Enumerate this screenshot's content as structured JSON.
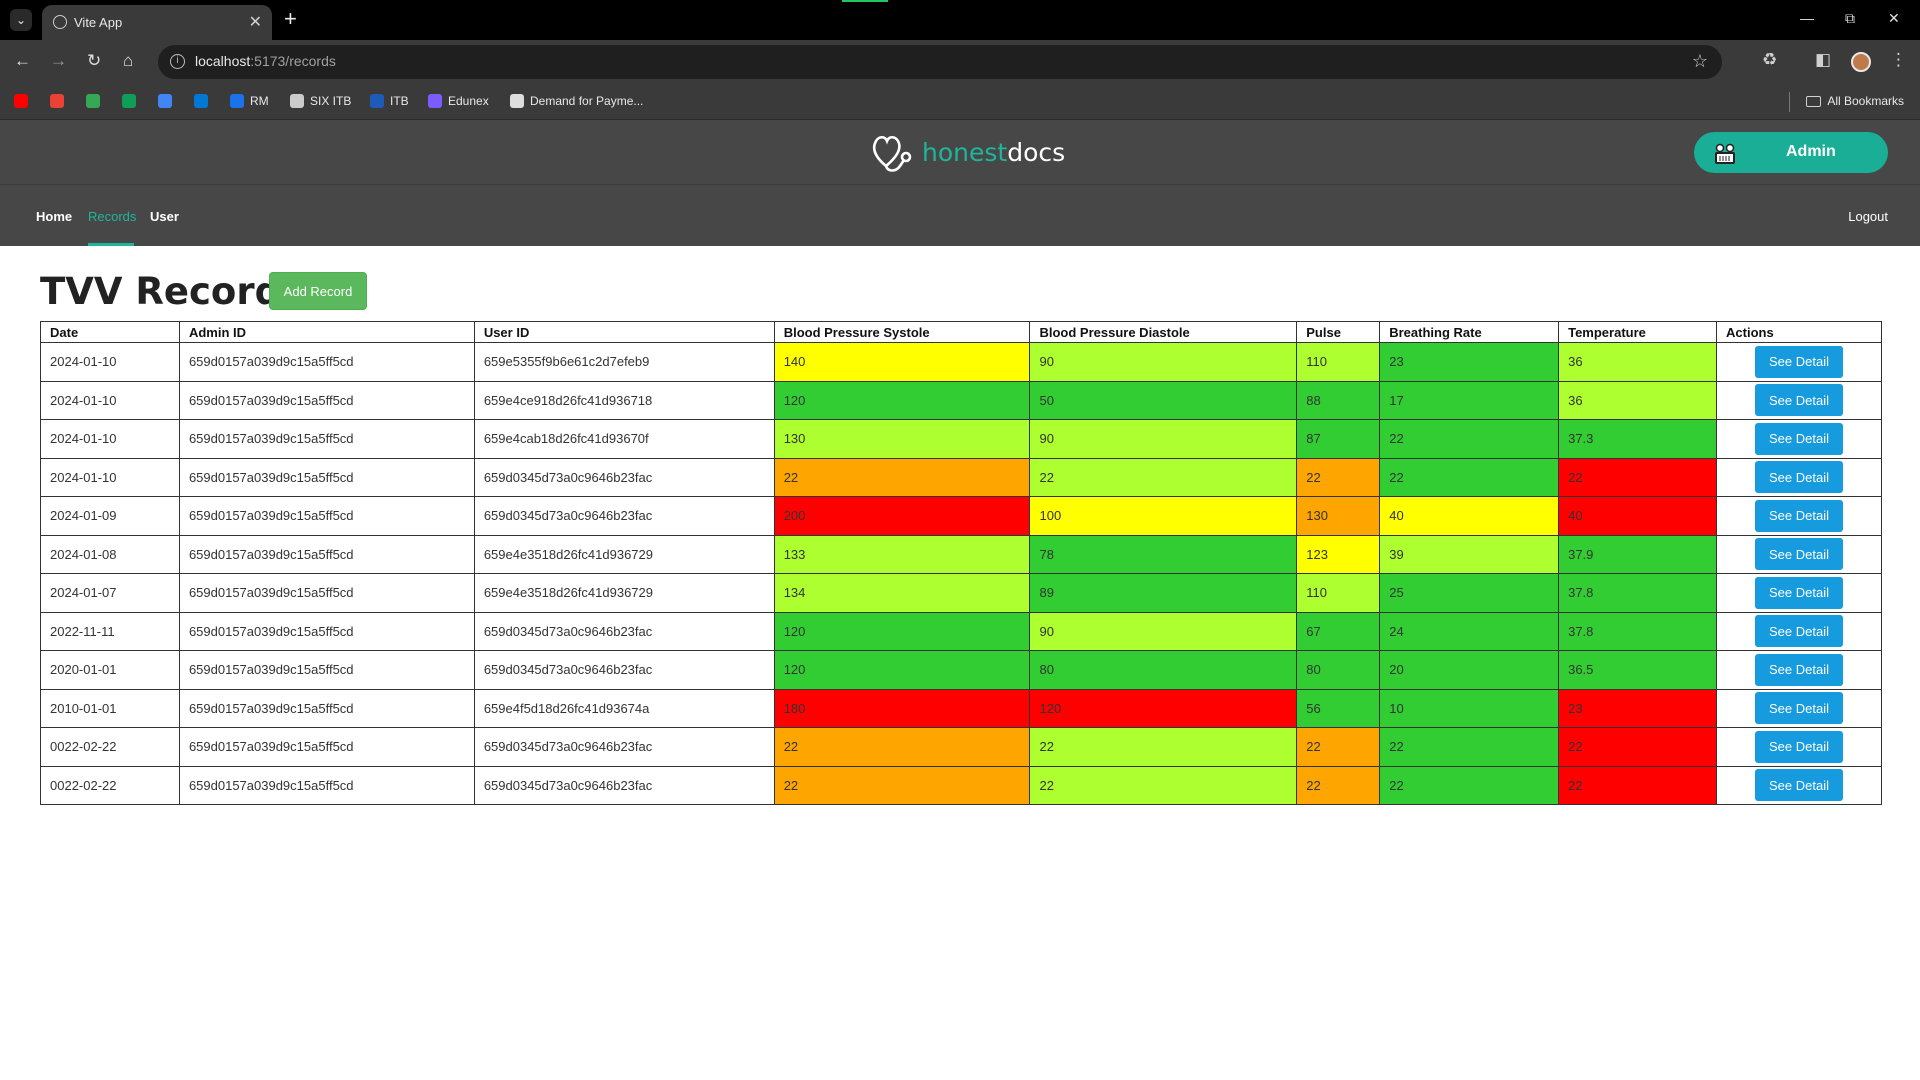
{
  "browser": {
    "tab_title": "Vite App",
    "url_host": "localhost",
    "url_path": ":5173/records",
    "bookmarks": [
      {
        "label": "",
        "icon": "youtube-icon",
        "color": "#ff0000"
      },
      {
        "label": "",
        "icon": "gmail-icon",
        "color": "#ea4335"
      },
      {
        "label": "",
        "icon": "drive-icon",
        "color": "#34a853"
      },
      {
        "label": "",
        "icon": "classroom-icon",
        "color": "#0f9d58"
      },
      {
        "label": "",
        "icon": "calendar-icon",
        "color": "#4285f4"
      },
      {
        "label": "",
        "icon": "outlook-icon",
        "color": "#0078d4"
      },
      {
        "label": "RM",
        "icon": "rm-icon",
        "color": "#1a73e8"
      },
      {
        "label": "SIX ITB",
        "icon": "six-itb-icon",
        "color": "#cccccc"
      },
      {
        "label": "ITB",
        "icon": "itb-icon",
        "color": "#1e5bb8"
      },
      {
        "label": "Edunex",
        "icon": "edunex-icon",
        "color": "#7c5cff"
      },
      {
        "label": "Demand for Payme...",
        "icon": "document-icon",
        "color": "#dddddd"
      }
    ],
    "all_bookmarks": "All Bookmarks"
  },
  "app": {
    "brand_honest": "honest",
    "brand_docs": "docs",
    "user_button": "Admin",
    "nav": {
      "home": "Home",
      "records": "Records",
      "user": "User",
      "logout": "Logout"
    },
    "accent": "#1fb59a"
  },
  "page": {
    "title": "TVV Records",
    "add_button": "Add Record",
    "columns": [
      "Date",
      "Admin ID",
      "User ID",
      "Blood Pressure Systole",
      "Blood Pressure Diastole",
      "Pulse",
      "Breathing Rate",
      "Temperature",
      "Actions"
    ],
    "detail_label": "See Detail",
    "status_colors": {
      "green": "#32cd32",
      "lime": "#adff2f",
      "yellow": "#ffff00",
      "orange": "#ffa500",
      "red": "#ff0000"
    },
    "rows": [
      {
        "date": "2024-01-10",
        "admin_id": "659d0157a039d9c15a5ff5cd",
        "user_id": "659e5355f9b6e61c2d7efeb9",
        "systole": {
          "v": "140",
          "s": "yellow"
        },
        "diastole": {
          "v": "90",
          "s": "lime"
        },
        "pulse": {
          "v": "110",
          "s": "lime"
        },
        "breathing": {
          "v": "23",
          "s": "green"
        },
        "temperature": {
          "v": "36",
          "s": "lime"
        }
      },
      {
        "date": "2024-01-10",
        "admin_id": "659d0157a039d9c15a5ff5cd",
        "user_id": "659e4ce918d26fc41d936718",
        "systole": {
          "v": "120",
          "s": "green"
        },
        "diastole": {
          "v": "50",
          "s": "green"
        },
        "pulse": {
          "v": "88",
          "s": "green"
        },
        "breathing": {
          "v": "17",
          "s": "green"
        },
        "temperature": {
          "v": "36",
          "s": "lime"
        }
      },
      {
        "date": "2024-01-10",
        "admin_id": "659d0157a039d9c15a5ff5cd",
        "user_id": "659e4cab18d26fc41d93670f",
        "systole": {
          "v": "130",
          "s": "lime"
        },
        "diastole": {
          "v": "90",
          "s": "lime"
        },
        "pulse": {
          "v": "87",
          "s": "green"
        },
        "breathing": {
          "v": "22",
          "s": "green"
        },
        "temperature": {
          "v": "37.3",
          "s": "green"
        }
      },
      {
        "date": "2024-01-10",
        "admin_id": "659d0157a039d9c15a5ff5cd",
        "user_id": "659d0345d73a0c9646b23fac",
        "systole": {
          "v": "22",
          "s": "orange"
        },
        "diastole": {
          "v": "22",
          "s": "lime"
        },
        "pulse": {
          "v": "22",
          "s": "orange"
        },
        "breathing": {
          "v": "22",
          "s": "green"
        },
        "temperature": {
          "v": "22",
          "s": "red"
        }
      },
      {
        "date": "2024-01-09",
        "admin_id": "659d0157a039d9c15a5ff5cd",
        "user_id": "659d0345d73a0c9646b23fac",
        "systole": {
          "v": "200",
          "s": "red"
        },
        "diastole": {
          "v": "100",
          "s": "yellow"
        },
        "pulse": {
          "v": "130",
          "s": "orange"
        },
        "breathing": {
          "v": "40",
          "s": "yellow"
        },
        "temperature": {
          "v": "40",
          "s": "red"
        }
      },
      {
        "date": "2024-01-08",
        "admin_id": "659d0157a039d9c15a5ff5cd",
        "user_id": "659e4e3518d26fc41d936729",
        "systole": {
          "v": "133",
          "s": "lime"
        },
        "diastole": {
          "v": "78",
          "s": "green"
        },
        "pulse": {
          "v": "123",
          "s": "yellow"
        },
        "breathing": {
          "v": "39",
          "s": "lime"
        },
        "temperature": {
          "v": "37.9",
          "s": "green"
        }
      },
      {
        "date": "2024-01-07",
        "admin_id": "659d0157a039d9c15a5ff5cd",
        "user_id": "659e4e3518d26fc41d936729",
        "systole": {
          "v": "134",
          "s": "lime"
        },
        "diastole": {
          "v": "89",
          "s": "green"
        },
        "pulse": {
          "v": "110",
          "s": "lime"
        },
        "breathing": {
          "v": "25",
          "s": "green"
        },
        "temperature": {
          "v": "37.8",
          "s": "green"
        }
      },
      {
        "date": "2022-11-11",
        "admin_id": "659d0157a039d9c15a5ff5cd",
        "user_id": "659d0345d73a0c9646b23fac",
        "systole": {
          "v": "120",
          "s": "green"
        },
        "diastole": {
          "v": "90",
          "s": "lime"
        },
        "pulse": {
          "v": "67",
          "s": "green"
        },
        "breathing": {
          "v": "24",
          "s": "green"
        },
        "temperature": {
          "v": "37.8",
          "s": "green"
        }
      },
      {
        "date": "2020-01-01",
        "admin_id": "659d0157a039d9c15a5ff5cd",
        "user_id": "659d0345d73a0c9646b23fac",
        "systole": {
          "v": "120",
          "s": "green"
        },
        "diastole": {
          "v": "80",
          "s": "green"
        },
        "pulse": {
          "v": "80",
          "s": "green"
        },
        "breathing": {
          "v": "20",
          "s": "green"
        },
        "temperature": {
          "v": "36.5",
          "s": "green"
        }
      },
      {
        "date": "2010-01-01",
        "admin_id": "659d0157a039d9c15a5ff5cd",
        "user_id": "659e4f5d18d26fc41d93674a",
        "systole": {
          "v": "180",
          "s": "red"
        },
        "diastole": {
          "v": "120",
          "s": "red"
        },
        "pulse": {
          "v": "56",
          "s": "green"
        },
        "breathing": {
          "v": "10",
          "s": "green"
        },
        "temperature": {
          "v": "23",
          "s": "red"
        }
      },
      {
        "date": "0022-02-22",
        "admin_id": "659d0157a039d9c15a5ff5cd",
        "user_id": "659d0345d73a0c9646b23fac",
        "systole": {
          "v": "22",
          "s": "orange"
        },
        "diastole": {
          "v": "22",
          "s": "lime"
        },
        "pulse": {
          "v": "22",
          "s": "orange"
        },
        "breathing": {
          "v": "22",
          "s": "green"
        },
        "temperature": {
          "v": "22",
          "s": "red"
        }
      },
      {
        "date": "0022-02-22",
        "admin_id": "659d0157a039d9c15a5ff5cd",
        "user_id": "659d0345d73a0c9646b23fac",
        "systole": {
          "v": "22",
          "s": "orange"
        },
        "diastole": {
          "v": "22",
          "s": "lime"
        },
        "pulse": {
          "v": "22",
          "s": "orange"
        },
        "breathing": {
          "v": "22",
          "s": "green"
        },
        "temperature": {
          "v": "22",
          "s": "red"
        }
      }
    ]
  }
}
